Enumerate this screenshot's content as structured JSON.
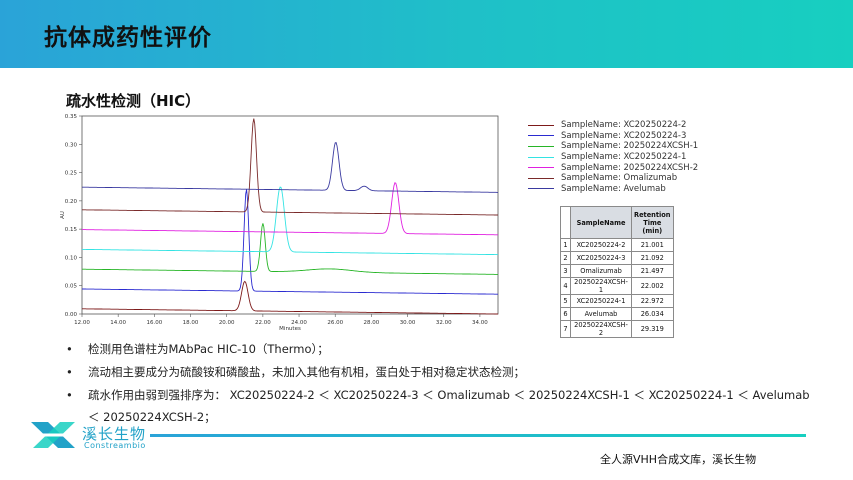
{
  "header": {
    "title": "抗体成药性评价"
  },
  "section": {
    "title": "疏水性检测（HIC）"
  },
  "chart_data": {
    "type": "line",
    "xlabel": "Minutes",
    "ylabel": "AU",
    "xlim": [
      12.0,
      35.0
    ],
    "ylim": [
      0.0,
      0.35
    ],
    "x_ticks": [
      "12.00",
      "14.00",
      "16.00",
      "18.00",
      "20.00",
      "22.00",
      "24.00",
      "26.00",
      "28.00",
      "30.00",
      "32.00",
      "34.00"
    ],
    "y_ticks": [
      "0.00",
      "0.05",
      "0.10",
      "0.15",
      "0.20",
      "0.25",
      "0.30",
      "0.35"
    ],
    "series": [
      {
        "name": "SampleName: XC20250224-2",
        "color": "#7d1a1a",
        "baseline": 0.0,
        "peaks": [
          [
            21.0,
            0.052,
            0.18
          ]
        ]
      },
      {
        "name": "SampleName: XC20250224-3",
        "color": "#2b2bd0",
        "baseline": 0.035,
        "peaks": [
          [
            21.09,
            0.18,
            0.13
          ]
        ]
      },
      {
        "name": "SampleName: 20250224XCSH-1",
        "color": "#27b527",
        "baseline": 0.07,
        "peaks": [
          [
            22.0,
            0.085,
            0.13
          ],
          [
            25.7,
            0.006,
            1.2
          ]
        ]
      },
      {
        "name": "SampleName: XC20250224-1",
        "color": "#33e3e3",
        "baseline": 0.105,
        "peaks": [
          [
            22.97,
            0.115,
            0.22
          ]
        ]
      },
      {
        "name": "SampleName: 20250224XCSH-2",
        "color": "#e020e0",
        "baseline": 0.14,
        "peaks": [
          [
            29.32,
            0.09,
            0.2
          ]
        ]
      },
      {
        "name": "SampleName: Omalizumab",
        "color": "#7a2a2a",
        "baseline": 0.175,
        "peaks": [
          [
            21.5,
            0.165,
            0.15
          ]
        ]
      },
      {
        "name": "SampleName: Avelumab",
        "color": "#3a3aa0",
        "baseline": 0.215,
        "peaks": [
          [
            26.03,
            0.085,
            0.18
          ],
          [
            27.6,
            0.008,
            0.2
          ]
        ]
      }
    ]
  },
  "rt_table": {
    "header": [
      "",
      "SampleName",
      "Retention Time (min)"
    ],
    "rows": [
      [
        "1",
        "XC20250224-2",
        "21.001"
      ],
      [
        "2",
        "XC20250224-3",
        "21.092"
      ],
      [
        "3",
        "Omalizumab",
        "21.497"
      ],
      [
        "4",
        "20250224XCSH-1",
        "22.002"
      ],
      [
        "5",
        "XC20250224-1",
        "22.972"
      ],
      [
        "6",
        "Avelumab",
        "26.034"
      ],
      [
        "7",
        "20250224XCSH-2",
        "29.319"
      ]
    ]
  },
  "bullets": [
    "检测用色谱柱为MAbPac HIC-10（Thermo）；",
    "流动相主要成分为硫酸铵和磷酸盐，未加入其他有机相，蛋白处于相对稳定状态检测；",
    "疏水作用由弱到强排序为： XC20250224-2 ＜ XC20250224-3 ＜ Omalizumab ＜ 20250224XCSH-1 ＜ XC20250224-1 ＜ Avelumab"
  ],
  "bullet_continuation": "＜ 20250224XCSH-2；",
  "bullet_symbol": "•",
  "logo": {
    "cn": "溪长生物",
    "en": "Constreambio",
    "color": "#22a2c8"
  },
  "footer": {
    "text": "全人源VHH合成文库，溪长生物"
  }
}
